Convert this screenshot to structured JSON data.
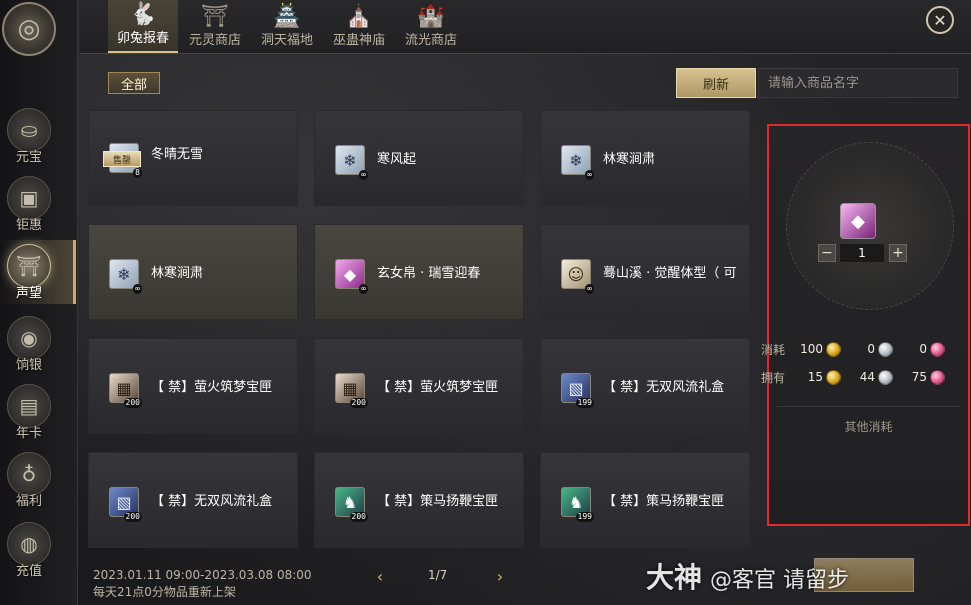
{
  "rail": {
    "logo_icon": "coin-emblem-icon",
    "items": [
      {
        "label": "元宝",
        "icon": "ingot-icon"
      },
      {
        "label": "钜惠",
        "icon": "treasure-chest-icon"
      },
      {
        "label": "声望",
        "icon": "reputation-gate-icon",
        "active": true
      },
      {
        "label": "饷银",
        "icon": "silver-coin-icon"
      },
      {
        "label": "年卡",
        "icon": "card-icon"
      },
      {
        "label": "福利",
        "icon": "gift-bag-icon"
      },
      {
        "label": "充值",
        "icon": "coin-stack-icon"
      }
    ]
  },
  "tabs": [
    {
      "label": "卯兔报春",
      "icon": "rabbit-icon",
      "active": true
    },
    {
      "label": "元灵商店",
      "icon": "shrine-icon"
    },
    {
      "label": "洞天福地",
      "icon": "palace-icon"
    },
    {
      "label": "巫蛊神庙",
      "icon": "temple-icon"
    },
    {
      "label": "流光商店",
      "icon": "pagoda-icon"
    }
  ],
  "filter": {
    "all_label": "全部"
  },
  "toolbar": {
    "refresh_label": "刷新",
    "search_placeholder": "请输入商品名字"
  },
  "items": [
    {
      "name": "冬晴无雪",
      "thumb": "snow",
      "badge": "8",
      "soldout": "售罄"
    },
    {
      "name": "寒风起",
      "thumb": "snow",
      "badge": "∞"
    },
    {
      "name": "林寒涧肃",
      "thumb": "snow",
      "badge": "∞"
    },
    {
      "name": "林寒涧肃",
      "thumb": "snow",
      "badge": "∞"
    },
    {
      "name": "玄女帛 · 瑞雪迎春",
      "thumb": "silk",
      "badge": "∞"
    },
    {
      "name": "蓦山溪 · 觉醒体型（ 可",
      "thumb": "char",
      "badge": "∞"
    },
    {
      "name": "【 禁】萤火筑梦宝匣",
      "thumb": "box1",
      "badge": "200"
    },
    {
      "name": "【 禁】萤火筑梦宝匣",
      "thumb": "box1",
      "badge": "200"
    },
    {
      "name": "【 禁】无双风流礼盒",
      "thumb": "box2",
      "badge": "199"
    },
    {
      "name": "【 禁】无双风流礼盒",
      "thumb": "box2",
      "badge": "200"
    },
    {
      "name": "【 禁】策马扬鞭宝匣",
      "thumb": "box3",
      "badge": "200"
    },
    {
      "name": "【 禁】策马扬鞭宝匣",
      "thumb": "box3",
      "badge": "199"
    }
  ],
  "detail": {
    "item_icon": "silk-bolt-icon",
    "quantity": "1",
    "cost_label": "消耗",
    "own_label": "拥有",
    "cost": [
      "100",
      "0",
      "0"
    ],
    "own": [
      "15",
      "44",
      "75"
    ],
    "other_cost_label": "其他消耗",
    "colors": {
      "highlight_border": "#e02b2b",
      "gold": "#d9a51d",
      "silver": "#b7bcc4",
      "pink": "#e0568a"
    }
  },
  "footer": {
    "time_range": "2023.01.11 09:00-2023.03.08 08:00",
    "note": "每天21点0分物品重新上架",
    "page": "1/7"
  },
  "watermark": {
    "brand": "大神",
    "handle": "@客官 请留步"
  }
}
